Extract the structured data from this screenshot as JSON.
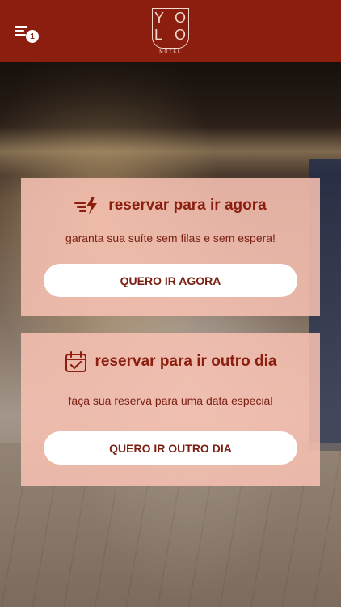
{
  "header": {
    "menu_icon": "menu-lines-icon",
    "notification_count": "1",
    "logo": {
      "line1": [
        "Y",
        "O"
      ],
      "line2": [
        "L",
        "O"
      ],
      "subtitle": "MOTEL"
    },
    "background_color": "#8b1e0f"
  },
  "cards": [
    {
      "icon": "fast-lightning-icon",
      "title": "reservar para ir agora",
      "subtitle": "garanta sua suíte sem filas e sem espera!",
      "button_label": "QUERO IR AGORA"
    },
    {
      "icon": "calendar-check-icon",
      "title": "reservar para ir outro dia",
      "subtitle": "faça sua reserva para uma data especial",
      "button_label": "QUERO IR OUTRO DIA"
    }
  ],
  "colors": {
    "accent": "#8b1e0f",
    "card_background": "#f6c0b2",
    "button_background": "#ffffff"
  }
}
